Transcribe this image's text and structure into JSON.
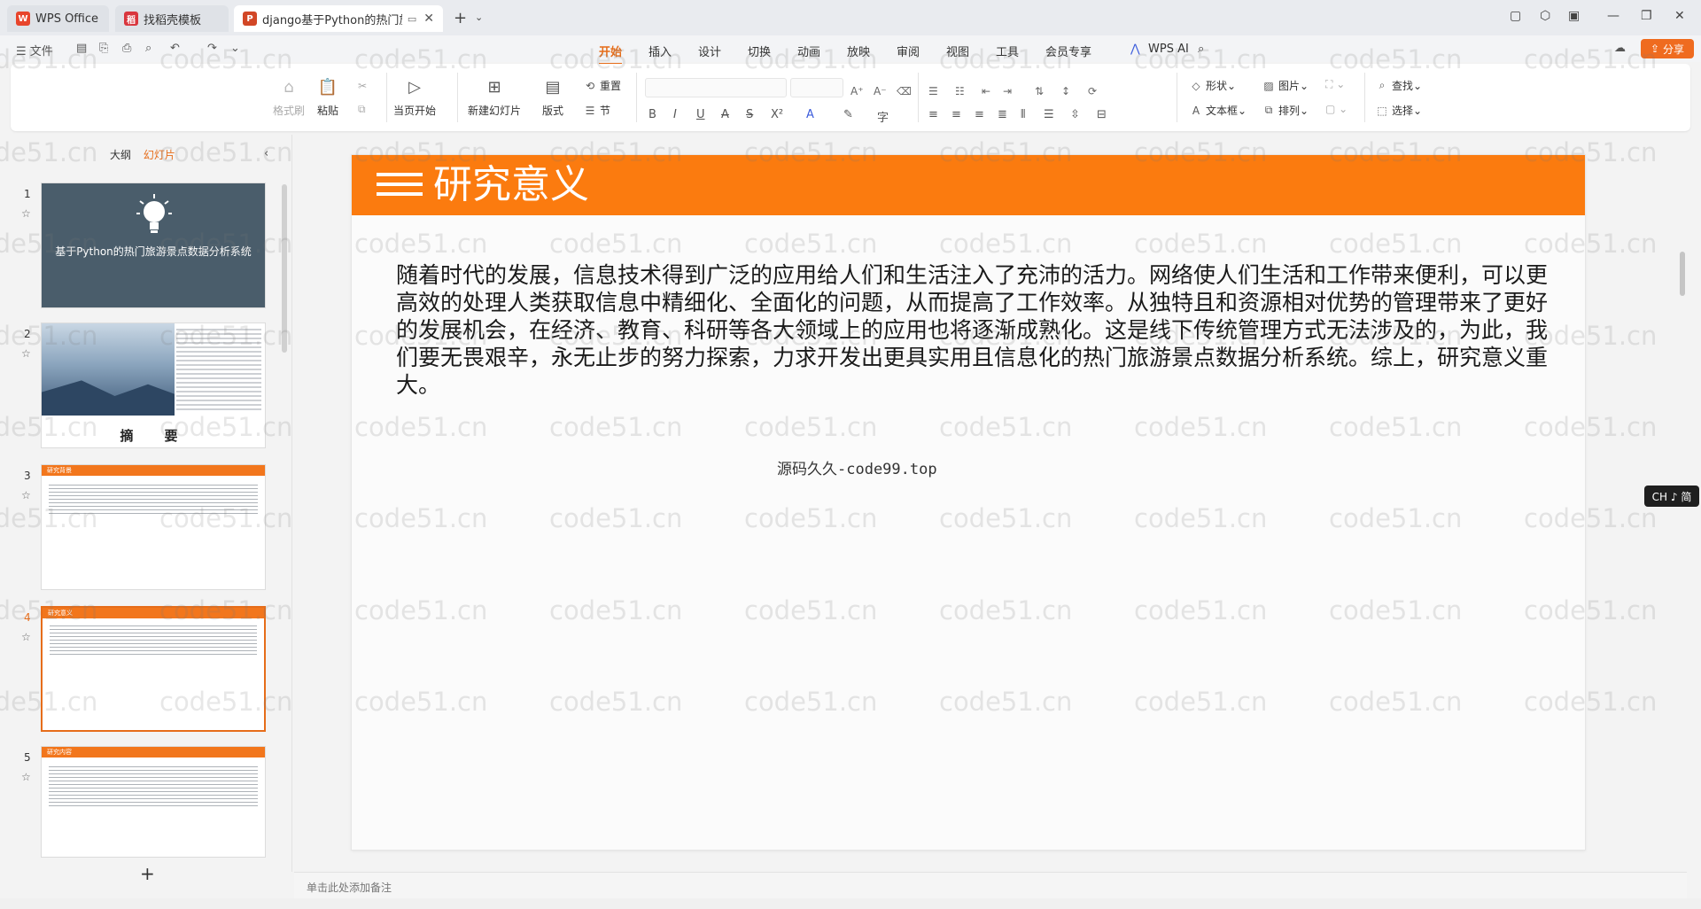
{
  "titlebar": {
    "tabs": [
      {
        "label": "WPS Office"
      },
      {
        "label": "找稻壳模板"
      },
      {
        "label": "django基于Python的热门旅"
      }
    ]
  },
  "menu": {
    "file": "文件",
    "tabs": [
      "开始",
      "插入",
      "设计",
      "切换",
      "动画",
      "放映",
      "审阅",
      "视图",
      "工具",
      "会员专享"
    ],
    "wps_ai": "WPS AI",
    "share": "分享"
  },
  "ribbon": {
    "format_painter": "格式刷",
    "paste": "粘贴",
    "play_from_current": "当页开始",
    "new_slide": "新建幻灯片",
    "layout": "版式",
    "reset": "重置",
    "section": "节",
    "shapes": "形状",
    "picture": "图片",
    "textbox": "文本框",
    "arrange": "排列",
    "find": "查找",
    "select": "选择"
  },
  "leftpanel": {
    "outline_tab": "大纲",
    "slides_tab": "幻灯片",
    "slides": [
      {
        "number": "1",
        "title": "基于Python的热门旅游景点数据分析系统"
      },
      {
        "number": "2",
        "title": "摘　要"
      },
      {
        "number": "3",
        "title": "研究背景"
      },
      {
        "number": "4",
        "title": "研究意义"
      },
      {
        "number": "5",
        "title": "研究内容"
      }
    ],
    "add_label": "+"
  },
  "slide": {
    "title": "研究意义",
    "body": "随着时代的发展，信息技术得到广泛的应用给人们和生活注入了充沛的活力。网络使人们生活和工作带来便利，可以更高效的处理人类获取信息中精细化、全面化的问题，从而提高了工作效率。从独特且和资源相对优势的管理带来了更好的发展机会，在经济、教育、科研等各大领域上的应用也将逐渐成熟化。这是线下传统管理方式无法涉及的，为此，我们要无畏艰辛，永无止步的努力探索，力求开发出更具实用且信息化的热门旅游景点数据分析系统。综上，研究意义重大。",
    "source_note": "源码久久-code99.top"
  },
  "notes": {
    "placeholder": "单击此处添加备注"
  },
  "ime": {
    "label": "CH ♪ 简"
  },
  "watermark": {
    "text": "code51.cn"
  },
  "colors": {
    "accent": "#e66d1a",
    "slide_header": "#fb7b0f",
    "thumb1_bg": "#4a5d6b"
  }
}
